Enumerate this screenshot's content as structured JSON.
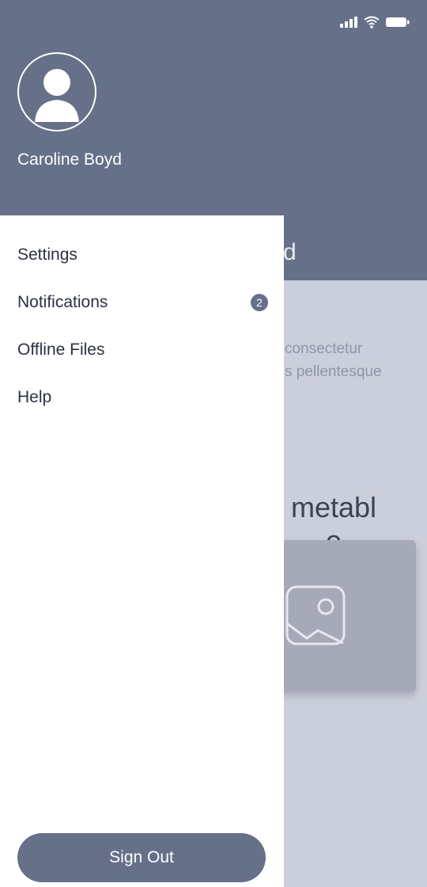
{
  "profile": {
    "name": "Caroline Boyd"
  },
  "background": {
    "title_fragment": "d",
    "paragraph_fragment": "consectetur\ns pellentesque",
    "heading_fragment": "metabl\ne"
  },
  "menu": {
    "items": [
      {
        "label": "Settings"
      },
      {
        "label": "Notifications",
        "badge": "2"
      },
      {
        "label": "Offline Files"
      },
      {
        "label": "Help"
      }
    ]
  },
  "footer": {
    "sign_out_label": "Sign Out"
  },
  "colors": {
    "primary": "#667089",
    "drawer_bg": "#ffffff",
    "page_bg": "#cbcfdb"
  },
  "icons": {
    "avatar": "user-silhouette-icon",
    "placeholder": "image-placeholder-icon",
    "signal": "signal-icon",
    "wifi": "wifi-icon",
    "battery": "battery-icon"
  }
}
